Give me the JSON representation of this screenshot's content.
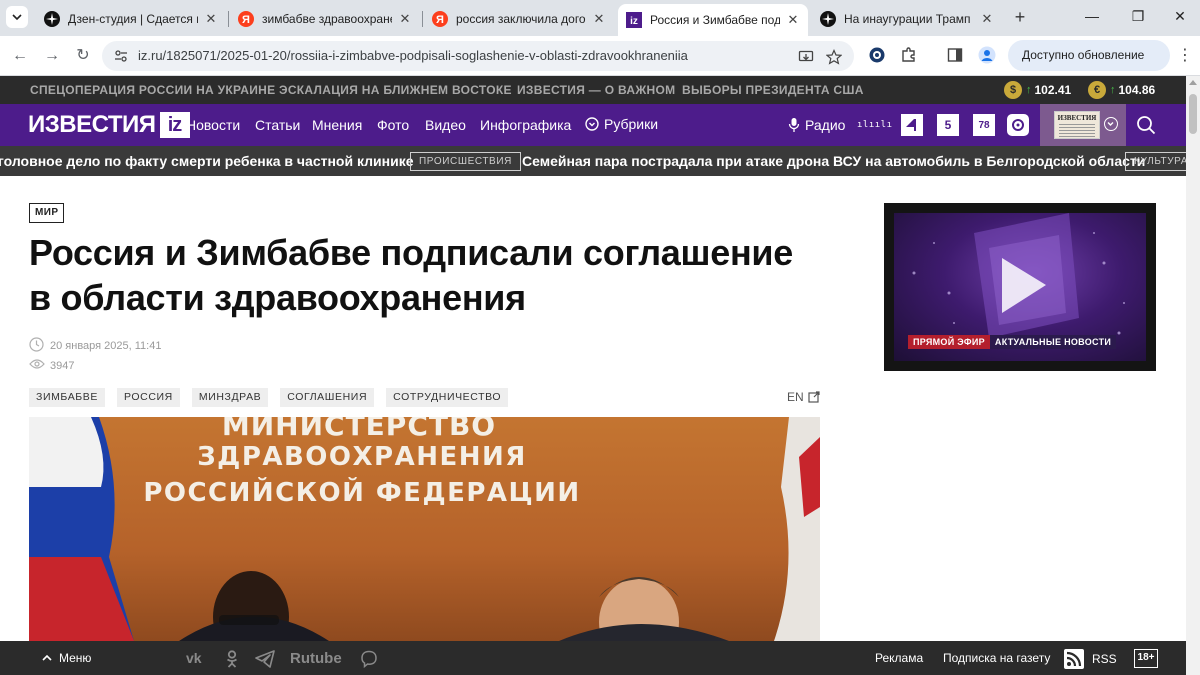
{
  "browser": {
    "tabs": [
      {
        "title": "Дзен-студия | Сдается мне...",
        "favicon": "dzen-icon",
        "active": false
      },
      {
        "title": "зимбабве здравоохранение",
        "favicon": "yandex-icon",
        "active": false
      },
      {
        "title": "россия заключила договор",
        "favicon": "yandex-icon",
        "active": false
      },
      {
        "title": "Россия и Зимбабве подписа",
        "favicon": "izvestia-icon",
        "active": true
      },
      {
        "title": "На инаугурации Трамп пре",
        "favicon": "dzen-icon",
        "active": false
      }
    ],
    "url": "iz.ru/1825071/2025-01-20/rossiia-i-zimbabve-podpisali-soglashenie-v-oblasti-zdravookhraneniia",
    "update_label": "Доступно обновление Chrome"
  },
  "site": {
    "topbar_links": [
      "СПЕЦОПЕРАЦИЯ РОССИИ НА УКРАИНЕ",
      "ЭСКАЛАЦИЯ НА БЛИЖНЕМ ВОСТОКЕ",
      "ИЗВЕСТИЯ — О ВАЖНОМ",
      "ВЫБОРЫ ПРЕЗИДЕНТА США"
    ],
    "currencies": [
      {
        "symbol": "$",
        "value": "102.41"
      },
      {
        "symbol": "€",
        "value": "104.86"
      }
    ],
    "logo_text": "ИЗВЕСТИЯ",
    "logo_badge": "iz",
    "nav": [
      "Новости",
      "Статьи",
      "Мнения",
      "Фото",
      "Видео",
      "Инфографика"
    ],
    "rubrics_label": "Рубрики",
    "radio_label": "Радио",
    "channel_badges": [
      "5",
      "78"
    ],
    "newspaper_mast": "ИЗВЕСТИЯ",
    "ticker": [
      {
        "text": "головное дело по факту смерти ребенка в частной клинике"
      },
      {
        "tag": "ПРОИСШЕСТВИЯ"
      },
      {
        "text": "Семейная пара пострадала при атаке дрона ВСУ на автомобиль в Белгородской области"
      },
      {
        "tag": "КУЛЬТУРА"
      }
    ]
  },
  "article": {
    "rubric": "МИР",
    "headline_line1": "Россия и Зимбабве подписали соглашение",
    "headline_line2": "в области здравоохранения",
    "date": "20 января 2025, 11:41",
    "views": "3947",
    "tags": [
      "ЗИМБАБВЕ",
      "РОССИЯ",
      "МИНЗДРАВ",
      "СОГЛАШЕНИЯ",
      "СОТРУДНИЧЕСТВО"
    ],
    "lang_link": "EN",
    "photo_text_lines": [
      "МИНИСТЕРСТВО",
      "ЗДРАВООХРАНЕНИЯ",
      "РОССИЙСКОЙ ФЕДЕРАЦИИ"
    ]
  },
  "video": {
    "live_label": "ПРЯМОЙ ЭФИР",
    "news_label": "АКТУАЛЬНЫЕ НОВОСТИ"
  },
  "bottom": {
    "menu_label": "Меню",
    "rutube_label": "Rutube",
    "ads_label": "Реклама",
    "subscribe_label": "Подписка на газету",
    "rss_label": "RSS",
    "age_label": "18+"
  },
  "colors": {
    "brand_purple": "#4d1c8b",
    "dark_bar": "#2b2b2b",
    "ticker_bar": "#3a3a3a",
    "live_red": "#b41f2d"
  }
}
